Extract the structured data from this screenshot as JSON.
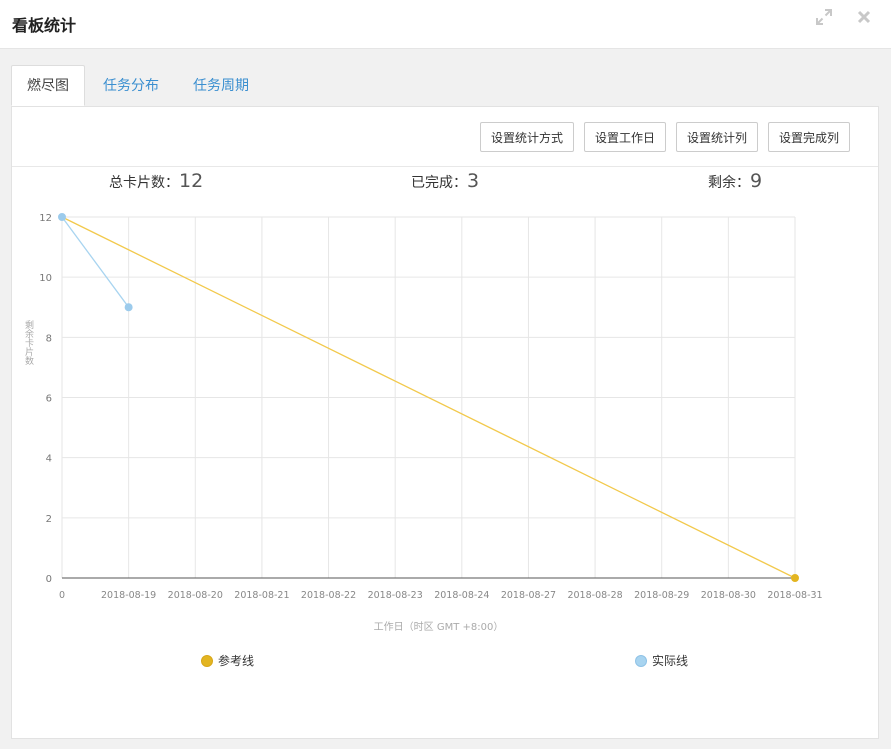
{
  "window": {
    "title": "看板统计"
  },
  "header_icons": [
    "expand-icon",
    "close-icon"
  ],
  "tabs": [
    {
      "label": "燃尽图",
      "active": true
    },
    {
      "label": "任务分布",
      "active": false
    },
    {
      "label": "任务周期",
      "active": false
    }
  ],
  "toolbar": {
    "stat_mode_label": "设置统计方式",
    "workday_label": "设置工作日",
    "stat_columns_label": "设置统计列",
    "done_columns_label": "设置完成列"
  },
  "stats": {
    "total_label": "总卡片数：",
    "total_value": "12",
    "done_label": "已完成：",
    "done_value": "3",
    "remaining_label": "剩余：",
    "remaining_value": "9"
  },
  "colors": {
    "reference": "#f2c94c",
    "reference_marker": "#e3b521",
    "actual": "#a8d4f0",
    "actual_marker": "#9ccbec",
    "grid": "#e6e6e6",
    "axis": "#999999",
    "tab_link": "#3b8fd0"
  },
  "chart_data": {
    "type": "line",
    "categories": [
      "0",
      "2018-08-19",
      "2018-08-20",
      "2018-08-21",
      "2018-08-22",
      "2018-08-23",
      "2018-08-24",
      "2018-08-27",
      "2018-08-28",
      "2018-08-29",
      "2018-08-30",
      "2018-08-31"
    ],
    "series": [
      {
        "name": "参考线",
        "values": [
          12,
          null,
          null,
          null,
          null,
          null,
          null,
          null,
          null,
          null,
          null,
          0
        ]
      },
      {
        "name": "实际线",
        "values": [
          12,
          9,
          null,
          null,
          null,
          null,
          null,
          null,
          null,
          null,
          null,
          null
        ]
      }
    ],
    "ylabel": "剩余卡片数",
    "xlabel": "工作日（时区 GMT +8:00）",
    "ylim": [
      0,
      12
    ],
    "yticks": [
      0,
      2,
      4,
      6,
      8,
      10,
      12
    ],
    "grid": true,
    "legend": "bottom"
  }
}
